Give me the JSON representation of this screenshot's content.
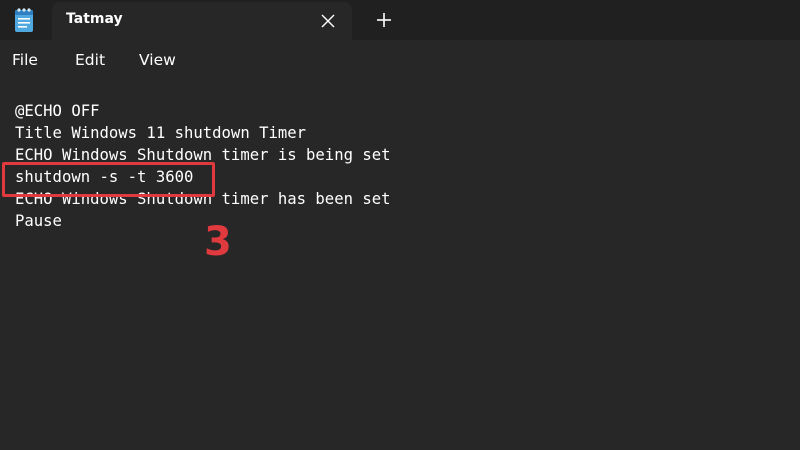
{
  "window": {
    "tab_title": "Tatmay",
    "close_glyph": "✕",
    "new_tab_glyph": "+"
  },
  "menu": {
    "items": [
      "File",
      "Edit",
      "View"
    ]
  },
  "editor": {
    "lines": [
      "@ECHO OFF",
      "Title Windows 11 shutdown Timer",
      "ECHO Windows Shutdown timer is being set",
      "shutdown -s -t 3600",
      "ECHO Windows Shutdown timer has been set",
      "Pause"
    ]
  },
  "annotation": {
    "step_number": "3",
    "color": "#e03a3e"
  },
  "icons": {
    "app": "notepad-icon",
    "close": "close-icon",
    "new_tab": "plus-icon"
  },
  "colors": {
    "titlebar": "#202020",
    "background": "#272727",
    "text": "#ffffff",
    "app_icon": "#4fa8e0"
  }
}
